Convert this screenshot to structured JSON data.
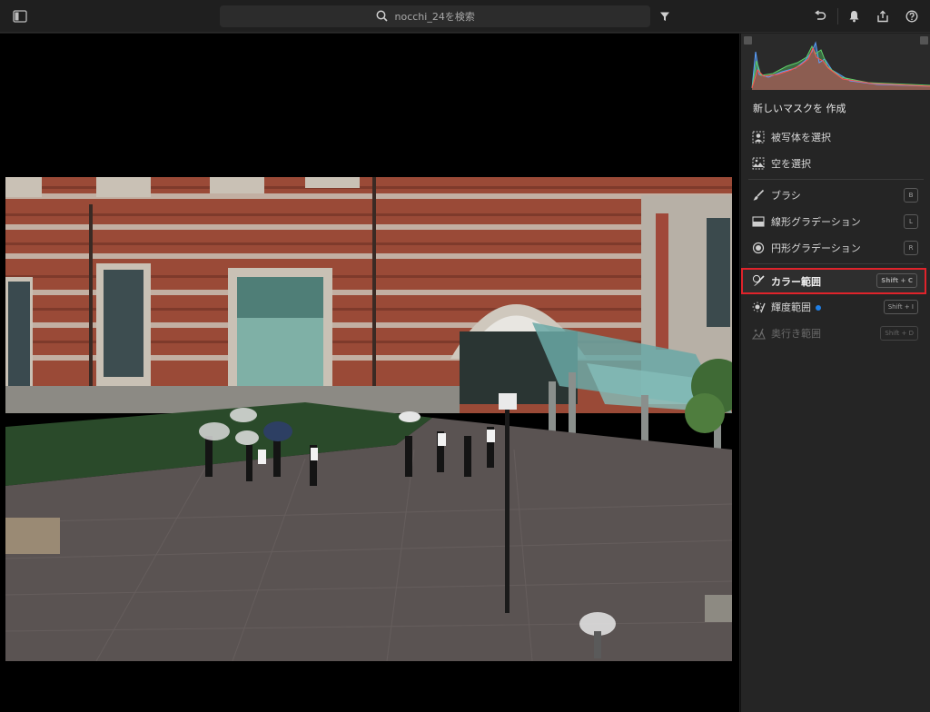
{
  "topbar": {
    "search_placeholder": "nocchi_24を検索"
  },
  "panel": {
    "title": "新しいマスクを 作成",
    "items": [
      {
        "label": "被写体を選択",
        "shortcut": "",
        "icon": "person-icon"
      },
      {
        "label": "空を選択",
        "shortcut": "",
        "icon": "sky-icon"
      },
      {
        "label": "ブラシ",
        "shortcut": "B",
        "icon": "brush-icon"
      },
      {
        "label": "線形グラデーション",
        "shortcut": "L",
        "icon": "linear-gradient-icon"
      },
      {
        "label": "円形グラデーション",
        "shortcut": "R",
        "icon": "radial-gradient-icon"
      },
      {
        "label": "カラー範囲",
        "shortcut": "Shift + C",
        "icon": "color-range-icon",
        "highlighted": true
      },
      {
        "label": "輝度範囲",
        "shortcut": "Shift + I",
        "icon": "luminance-range-icon",
        "badge": "new"
      },
      {
        "label": "奥行き範囲",
        "shortcut": "Shift + D",
        "icon": "depth-range-icon",
        "disabled": true
      }
    ]
  },
  "colors": {
    "highlight_border": "#e0232b",
    "badge_dot": "#1f7fe6",
    "panel_bg": "#252525"
  }
}
